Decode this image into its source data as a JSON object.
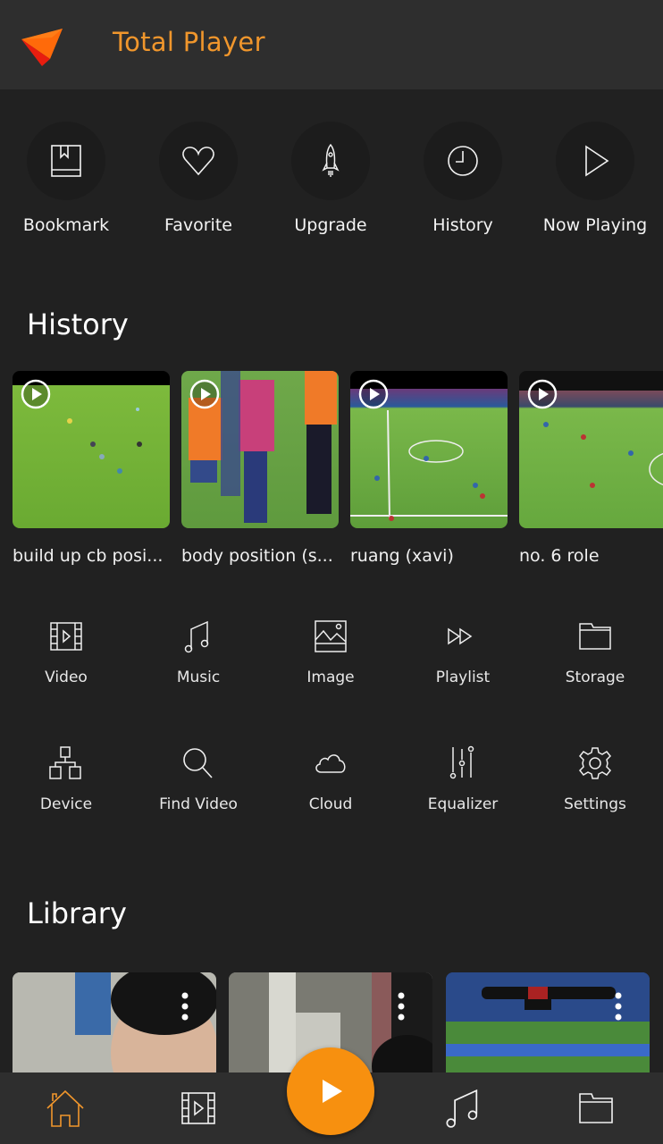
{
  "app": {
    "title": "Total Player",
    "accent_color": "#f0962c",
    "fab_color": "#f7900f"
  },
  "quick_actions": [
    {
      "label": "Bookmark",
      "icon": "bookmark-book-icon"
    },
    {
      "label": "Favorite",
      "icon": "heart-icon"
    },
    {
      "label": "Upgrade",
      "icon": "rocket-icon"
    },
    {
      "label": "History",
      "icon": "clock-icon"
    },
    {
      "label": "Now Playing",
      "icon": "play-icon"
    }
  ],
  "history": {
    "title": "History",
    "items": [
      {
        "caption": "build up cb posi...",
        "thumbnail": "football pitch aerial view"
      },
      {
        "caption": "body position (s...",
        "thumbnail": "players in training bibs"
      },
      {
        "caption": "ruang (xavi)",
        "thumbnail": "match broadcast view"
      },
      {
        "caption": "no. 6 role",
        "thumbnail": "match broadcast with text overlay"
      }
    ]
  },
  "categories_row1": [
    {
      "label": "Video",
      "icon": "film-icon"
    },
    {
      "label": "Music",
      "icon": "music-note-icon"
    },
    {
      "label": "Image",
      "icon": "image-icon"
    },
    {
      "label": "Playlist",
      "icon": "fast-forward-icon"
    },
    {
      "label": "Storage",
      "icon": "folder-icon"
    }
  ],
  "categories_row2": [
    {
      "label": "Device",
      "icon": "network-icon"
    },
    {
      "label": "Find Video",
      "icon": "search-icon"
    },
    {
      "label": "Cloud",
      "icon": "cloud-icon"
    },
    {
      "label": "Equalizer",
      "icon": "equalizer-icon"
    },
    {
      "label": "Settings",
      "icon": "gear-icon"
    }
  ],
  "library": {
    "title": "Library",
    "items": [
      {
        "thumbnail": "child face close-up"
      },
      {
        "thumbnail": "room with window"
      },
      {
        "thumbnail": "football broadcast scoreboard"
      }
    ]
  },
  "bottom_nav": [
    {
      "name": "home",
      "icon": "home-icon",
      "active": true
    },
    {
      "name": "videos",
      "icon": "film-icon",
      "active": false
    },
    {
      "name": "music",
      "icon": "music-note-icon",
      "active": false
    },
    {
      "name": "folders",
      "icon": "folder-icon",
      "active": false
    }
  ]
}
